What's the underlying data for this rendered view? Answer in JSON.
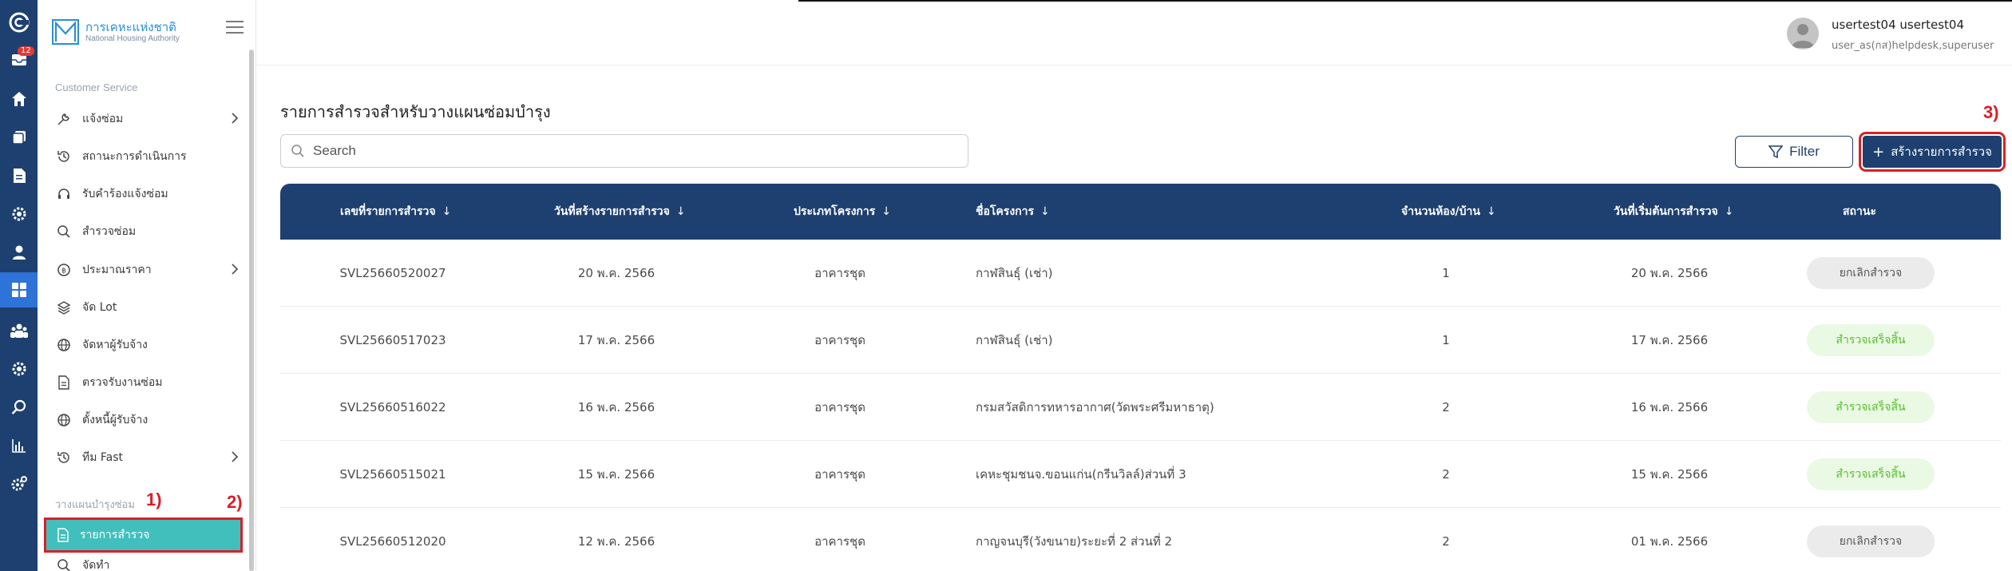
{
  "app": {
    "logo_th": "การเคหะแห่งชาติ",
    "logo_en": "National Housing Authority"
  },
  "rail": {
    "badge": "12",
    "icons": [
      "logo-c-icon",
      "inbox-icon",
      "home-icon",
      "copy-icon",
      "document-icon",
      "gear-icon",
      "user-icon",
      "dashboard-icon",
      "group-icon",
      "gear-icon",
      "search-icon",
      "bar-chart-icon",
      "settings-icon"
    ]
  },
  "sidebar": {
    "section_customer": "Customer Service",
    "items": [
      {
        "label": "แจ้งซ่อม",
        "icon": "wrench-icon",
        "has_chevron": true
      },
      {
        "label": "สถานะการดำเนินการ",
        "icon": "history-icon",
        "has_chevron": false
      },
      {
        "label": "รับคำร้องแจ้งซ่อม",
        "icon": "headset-icon",
        "has_chevron": false
      },
      {
        "label": "สำรวจซ่อม",
        "icon": "search-icon",
        "has_chevron": false
      },
      {
        "label": "ประมาณราคา",
        "icon": "coin-icon",
        "has_chevron": true
      },
      {
        "label": "จัด Lot",
        "icon": "layers-icon",
        "has_chevron": false
      },
      {
        "label": "จัดหาผู้รับจ้าง",
        "icon": "globe-icon",
        "has_chevron": false
      },
      {
        "label": "ตรวจรับงานซ่อม",
        "icon": "document-icon",
        "has_chevron": false
      },
      {
        "label": "ตั้งหนี้ผู้รับจ้าง",
        "icon": "globe-icon",
        "has_chevron": false
      },
      {
        "label": "ทีม Fast",
        "icon": "history-icon",
        "has_chevron": true
      }
    ],
    "section_plan": "วางแผนบำรุงซ่อม",
    "active_item": "รายการสำรวจ",
    "next_item": "จัดทำ"
  },
  "annotations": {
    "a1": "1)",
    "a2": "2)",
    "a3": "3)"
  },
  "user": {
    "name": "usertest04 usertest04",
    "role": "user_as(กส)helpdesk,superuser"
  },
  "main": {
    "title": "รายการสำรวจสำหรับวางแผนซ่อมบำรุง",
    "search_placeholder": "Search",
    "filter_label": "Filter",
    "create_label": "สร้างรายการสำรวจ"
  },
  "table": {
    "columns": [
      "เลขที่รายการสำรวจ",
      "วันที่สร้างรายการสำรวจ",
      "ประเภทโครงการ",
      "ชื่อโครงการ",
      "จำนวนห้อง/บ้าน",
      "วันที่เริ่มต้นการสำรวจ",
      "สถานะ"
    ],
    "rows": [
      {
        "id": "SVL25660520027",
        "created": "20 พ.ค. 2566",
        "type": "อาคารชุด",
        "project": "กาฬสินธุ์ (เช่า)",
        "units": "1",
        "start": "20 พ.ค. 2566",
        "status": "ยกเลิกสำรวจ",
        "status_kind": "cancel"
      },
      {
        "id": "SVL25660517023",
        "created": "17 พ.ค. 2566",
        "type": "อาคารชุด",
        "project": "กาฬสินธุ์ (เช่า)",
        "units": "1",
        "start": "17 พ.ค. 2566",
        "status": "สำรวจเสร็จสิ้น",
        "status_kind": "done"
      },
      {
        "id": "SVL25660516022",
        "created": "16 พ.ค. 2566",
        "type": "อาคารชุด",
        "project": "กรมสวัสดิการทหารอากาศ(วัดพระศรีมหาธาตุ)",
        "units": "2",
        "start": "16 พ.ค. 2566",
        "status": "สำรวจเสร็จสิ้น",
        "status_kind": "done"
      },
      {
        "id": "SVL25660515021",
        "created": "15 พ.ค. 2566",
        "type": "อาคารชุด",
        "project": "เคหะชุมชนจ.ขอนแก่น(กรีนวิลล์)ส่วนที่ 3",
        "units": "2",
        "start": "15 พ.ค. 2566",
        "status": "สำรวจเสร็จสิ้น",
        "status_kind": "done"
      },
      {
        "id": "SVL25660512020",
        "created": "12 พ.ค. 2566",
        "type": "อาคารชุด",
        "project": "กาญจนบุรี(วังขนาย)ระยะที่ 2 ส่วนที่ 2",
        "units": "2",
        "start": "01 พ.ค. 2566",
        "status": "ยกเลิกสำรวจ",
        "status_kind": "cancel"
      }
    ]
  },
  "colors": {
    "navy": "#1e4070",
    "teal": "#41bfbd",
    "annotation_red": "#d91f26",
    "done_bg": "#eaf9e4",
    "done_text": "#56c02b",
    "cancel_bg": "#ebebeb",
    "cancel_text": "#555555"
  }
}
